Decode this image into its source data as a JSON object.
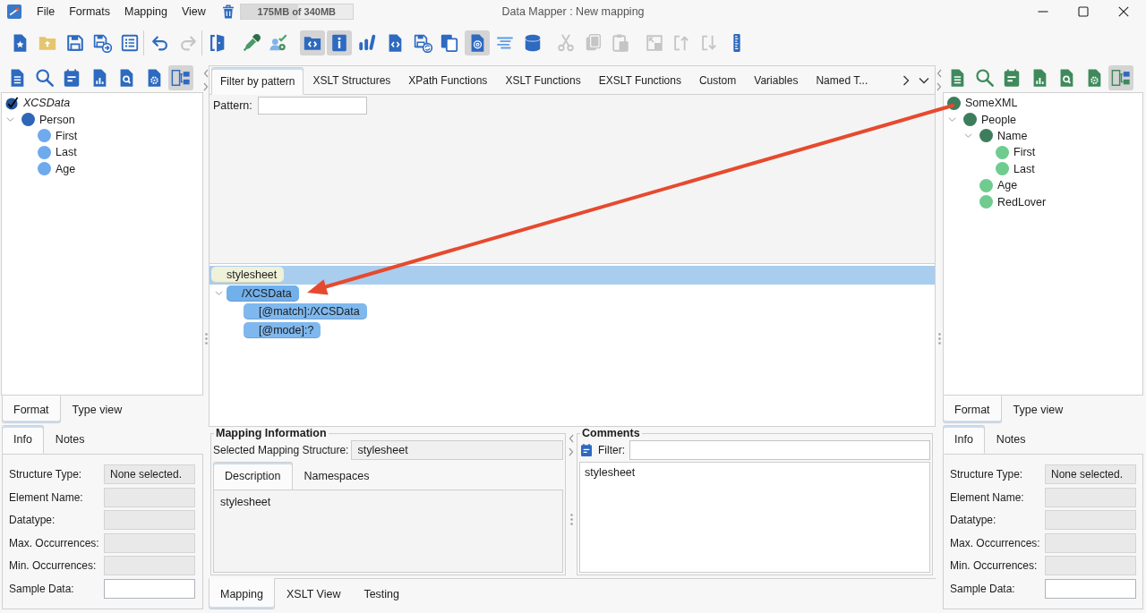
{
  "window": {
    "title": "Data Mapper : New mapping"
  },
  "menu": [
    {
      "label": "File"
    },
    {
      "label": "Formats"
    },
    {
      "label": "Mapping"
    },
    {
      "label": "View"
    }
  ],
  "memory": {
    "text": "175MB of 340MB",
    "level": 0.51
  },
  "toolbar": {
    "groups": [
      {
        "divider": true,
        "buttons": [
          {
            "pressed": false,
            "disabled": false
          },
          {
            "pressed": false,
            "disabled": false
          },
          {
            "pressed": false,
            "disabled": false
          },
          {
            "pressed": false,
            "disabled": false
          },
          {
            "pressed": false,
            "disabled": false
          }
        ]
      },
      {
        "divider": true,
        "buttons": [
          {
            "pressed": false,
            "disabled": false
          },
          {
            "pressed": false,
            "disabled": true
          }
        ]
      },
      {
        "divider": false,
        "buttons": [
          {
            "pressed": false,
            "disabled": false
          }
        ]
      },
      {
        "divider": false,
        "buttons": [
          {
            "pressed": false,
            "disabled": false
          },
          {
            "pressed": false,
            "disabled": false
          }
        ]
      },
      {
        "divider": false,
        "buttons": [
          {
            "pressed": true,
            "disabled": false
          },
          {
            "pressed": true,
            "disabled": false
          },
          {
            "pressed": false,
            "disabled": false
          },
          {
            "pressed": false,
            "disabled": false
          },
          {
            "pressed": false,
            "disabled": false
          },
          {
            "pressed": false,
            "disabled": false
          },
          {
            "pressed": true,
            "disabled": false
          },
          {
            "pressed": false,
            "disabled": false
          },
          {
            "pressed": false,
            "disabled": false
          }
        ]
      },
      {
        "divider": false,
        "buttons": [
          {
            "pressed": false,
            "disabled": true
          },
          {
            "pressed": false,
            "disabled": true
          },
          {
            "pressed": false,
            "disabled": true
          }
        ]
      },
      {
        "divider": false,
        "buttons": [
          {
            "pressed": false,
            "disabled": true
          },
          {
            "pressed": false,
            "disabled": true
          },
          {
            "pressed": false,
            "disabled": true
          },
          {
            "pressed": false,
            "disabled": false
          }
        ]
      }
    ]
  },
  "source_panel": {
    "tools": [
      {
        "pressed": false
      },
      {
        "pressed": false
      },
      {
        "pressed": false
      },
      {
        "pressed": false
      },
      {
        "pressed": false
      },
      {
        "pressed": false
      },
      {
        "pressed": true
      }
    ],
    "tree": [
      {
        "label": "XCSData",
        "kind": "check",
        "children": [
          {
            "label": "Person",
            "kind": "dot",
            "color": "#2e66b8",
            "expanded": true,
            "children": [
              {
                "label": "First",
                "kind": "dot",
                "color": "#6fa9ee"
              },
              {
                "label": "Last",
                "kind": "dot",
                "color": "#6fa9ee"
              },
              {
                "label": "Age",
                "kind": "dot",
                "color": "#6fa9ee"
              }
            ]
          }
        ]
      }
    ],
    "view_tabs": [
      {
        "label": "Format",
        "selected": true
      },
      {
        "label": "Type view",
        "selected": false
      }
    ],
    "info_tabs": [
      {
        "label": "Info",
        "selected": true
      },
      {
        "label": "Notes",
        "selected": false
      }
    ],
    "fields": [
      {
        "label": "Structure Type:",
        "value": "None selected.",
        "disabled": true
      },
      {
        "label": "Element Name:",
        "disabled": true
      },
      {
        "label": "Datatype:",
        "disabled": true
      },
      {
        "label": "Max. Occurrences:",
        "disabled": true
      },
      {
        "label": "Min. Occurrences:",
        "disabled": true
      },
      {
        "label": "Sample Data:",
        "disabled": false
      }
    ]
  },
  "functions_panel": {
    "tabs": [
      {
        "label": "Filter by pattern",
        "selected": true
      },
      {
        "label": "XSLT Structures",
        "selected": false
      },
      {
        "label": "XPath Functions",
        "selected": false
      },
      {
        "label": "XSLT Functions",
        "selected": false
      },
      {
        "label": "EXSLT Functions",
        "selected": false
      },
      {
        "label": "Custom",
        "selected": false
      },
      {
        "label": "Variables",
        "selected": false
      },
      {
        "label": "Named T...",
        "selected": false
      }
    ],
    "pattern": {
      "label": "Pattern:"
    }
  },
  "mapping_tree": [
    {
      "label": "stylesheet",
      "color": "#eff1d8",
      "selected": true,
      "children": [
        {
          "label": "/XCSData",
          "color": "#72b0ec",
          "selected": false,
          "expanded": true,
          "children": [
            {
              "label": "[@match]:/XCSData",
              "color": "#7fb8ee",
              "selected": false
            },
            {
              "label": "[@mode]:?",
              "color": "#7fb8ee",
              "selected": false
            }
          ]
        }
      ]
    }
  ],
  "target_panel": {
    "tools": [
      {
        "pressed": false
      },
      {
        "pressed": false
      },
      {
        "pressed": false
      },
      {
        "pressed": false
      },
      {
        "pressed": false
      },
      {
        "pressed": false
      },
      {
        "pressed": true
      }
    ],
    "tree": [
      {
        "label": "SomeXML",
        "kind": "dot",
        "color": "#3e7d5b",
        "children": [
          {
            "label": "People",
            "kind": "dot",
            "color": "#3e7d5b",
            "expanded": true,
            "children": [
              {
                "label": "Name",
                "kind": "dot",
                "color": "#3e7d5b",
                "expanded": true,
                "children": [
                  {
                    "label": "First",
                    "kind": "dot",
                    "color": "#6fcb8e"
                  },
                  {
                    "label": "Last",
                    "kind": "dot",
                    "color": "#6fcb8e"
                  }
                ]
              },
              {
                "label": "Age",
                "kind": "dot",
                "color": "#6fcb8e"
              },
              {
                "label": "RedLover",
                "kind": "dot",
                "color": "#6fcb8e"
              }
            ]
          }
        ]
      }
    ],
    "view_tabs": [
      {
        "label": "Format",
        "selected": true
      },
      {
        "label": "Type view",
        "selected": false
      }
    ],
    "info_tabs": [
      {
        "label": "Info",
        "selected": true
      },
      {
        "label": "Notes",
        "selected": false
      }
    ],
    "fields": [
      {
        "label": "Structure Type:",
        "value": "None selected.",
        "disabled": true
      },
      {
        "label": "Element Name:",
        "disabled": true
      },
      {
        "label": "Datatype:",
        "disabled": true
      },
      {
        "label": "Max. Occurrences:",
        "disabled": true
      },
      {
        "label": "Min. Occurrences:",
        "disabled": true
      },
      {
        "label": "Sample Data:",
        "disabled": false
      }
    ]
  },
  "mapping_info": {
    "title": "Mapping Information",
    "structure_label": "Selected Mapping Structure:",
    "structure_value": "stylesheet",
    "tabs": [
      {
        "label": "Description",
        "selected": true
      },
      {
        "label": "Namespaces",
        "selected": false
      }
    ],
    "description": "stylesheet"
  },
  "comments": {
    "title": "Comments",
    "filter_label": "Filter:",
    "text": "stylesheet"
  },
  "bottom_tabs": [
    {
      "label": "Mapping",
      "selected": true
    },
    {
      "label": "XSLT View",
      "selected": false
    },
    {
      "label": "Testing",
      "selected": false
    }
  ]
}
